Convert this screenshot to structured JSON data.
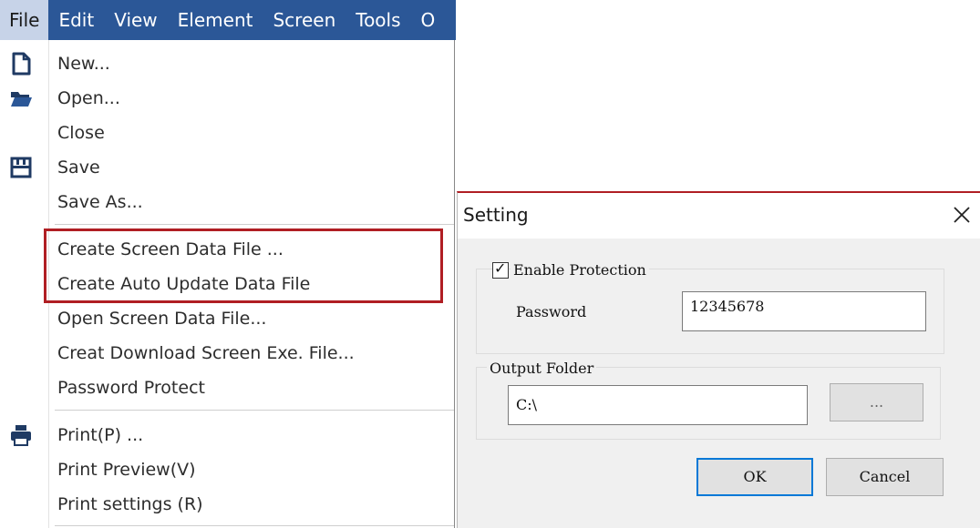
{
  "menubar": {
    "items": [
      {
        "label": "File",
        "active": true
      },
      {
        "label": "Edit"
      },
      {
        "label": "View"
      },
      {
        "label": "Element"
      },
      {
        "label": "Screen"
      },
      {
        "label": "Tools"
      },
      {
        "label": "O"
      }
    ]
  },
  "file_menu": {
    "new": "New...",
    "open": "Open...",
    "close": "Close",
    "save": "Save",
    "save_as": "Save As...",
    "create_screen_data_file": "Create Screen Data File ...",
    "create_auto_update_data_file": "Create Auto Update Data File",
    "open_screen_data_file": "Open Screen Data File...",
    "creat_download_screen_exe": "Creat Download Screen Exe. File...",
    "password_protect": "Password Protect",
    "print": "Print(P) ...",
    "print_preview": "Print Preview(V)",
    "print_settings": "Print settings (R)"
  },
  "icons": {
    "new": "new-document-icon",
    "open": "open-folder-icon",
    "save": "save-disk-icon",
    "print": "printer-icon"
  },
  "colors": {
    "menubar_bg": "#2b5797",
    "highlight": "#b01e23",
    "default_button_border": "#0078d7"
  },
  "dialog": {
    "title": "Setting",
    "enable_protection_label": "Enable Protection",
    "enable_protection_checked": true,
    "checkmark": "✓",
    "password_label": "Password",
    "password_value": "12345678",
    "output_folder_label": "Output Folder",
    "output_folder_value": "C:\\",
    "browse_label": "...",
    "ok_label": "OK",
    "cancel_label": "Cancel"
  }
}
